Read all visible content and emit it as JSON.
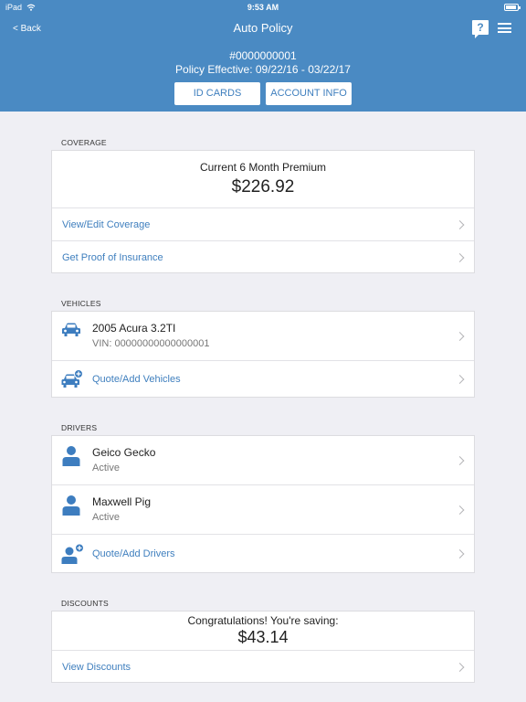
{
  "status_bar": {
    "device": "iPad",
    "time": "9:53 AM"
  },
  "header": {
    "back_label": "< Back",
    "title": "Auto Policy",
    "help_icon": "?",
    "policy_number": "#0000000001",
    "policy_effective": "Policy Effective:  09/22/16 - 03/22/17",
    "id_cards_label": "ID CARDS",
    "account_info_label": "ACCOUNT INFO"
  },
  "coverage": {
    "section_label": "COVERAGE",
    "premium_label": "Current 6 Month Premium",
    "premium_amount": "$226.92",
    "view_edit_label": "View/Edit Coverage",
    "proof_label": "Get Proof of Insurance"
  },
  "vehicles": {
    "section_label": "VEHICLES",
    "items": [
      {
        "name": "2005 Acura 3.2TI",
        "vin": "VIN: 00000000000000001"
      }
    ],
    "add_label": "Quote/Add Vehicles"
  },
  "drivers": {
    "section_label": "DRIVERS",
    "items": [
      {
        "name": "Geico Gecko",
        "status": "Active"
      },
      {
        "name": "Maxwell Pig",
        "status": "Active"
      }
    ],
    "add_label": "Quote/Add Drivers"
  },
  "discounts": {
    "section_label": "DISCOUNTS",
    "saving_label": "Congratulations! You're saving:",
    "saving_amount": "$43.14",
    "view_label": "View Discounts"
  },
  "colors": {
    "header_blue": "#4a8ac3",
    "link_blue": "#3f7fbe",
    "icon_blue": "#3d7dbf",
    "background": "#efeff4"
  }
}
